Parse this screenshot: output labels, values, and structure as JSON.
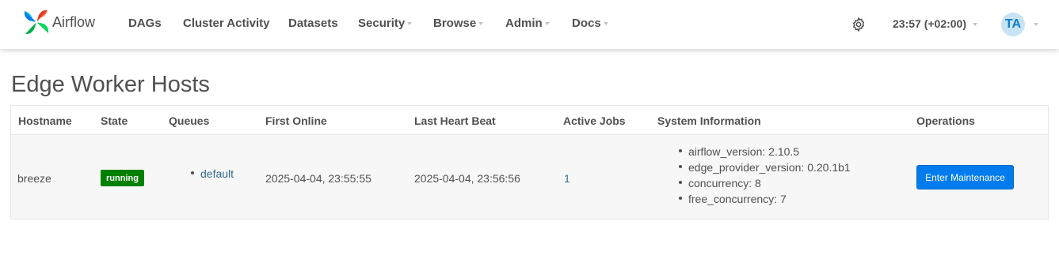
{
  "brand": {
    "name": "Airflow"
  },
  "nav": {
    "items": [
      {
        "label": "DAGs"
      },
      {
        "label": "Cluster Activity"
      },
      {
        "label": "Datasets"
      },
      {
        "label": "Security"
      },
      {
        "label": "Browse"
      },
      {
        "label": "Admin"
      },
      {
        "label": "Docs"
      }
    ],
    "time": "23:57 (+02:00)",
    "avatar_initials": "TA",
    "icons": {
      "settings": "gear-icon"
    }
  },
  "page": {
    "title": "Edge Worker Hosts"
  },
  "table": {
    "headers": [
      "Hostname",
      "State",
      "Queues",
      "First Online",
      "Last Heart Beat",
      "Active Jobs",
      "System Information",
      "Operations"
    ],
    "rows": [
      {
        "hostname": "breeze",
        "state": "running",
        "queues": [
          "default"
        ],
        "first_online": "2025-04-04, 23:55:55",
        "last_heart_beat": "2025-04-04, 23:56:56",
        "active_jobs": "1",
        "system_information": [
          "airflow_version: 2.10.5",
          "edge_provider_version: 0.20.1b1",
          "concurrency: 8",
          "free_concurrency: 7"
        ],
        "operation_label": "Enter Maintenance"
      }
    ]
  },
  "colors": {
    "state_running": "#008000",
    "primary_button": "#017cee",
    "link": "#336b8c",
    "avatar_bg": "#c7e3f5"
  }
}
